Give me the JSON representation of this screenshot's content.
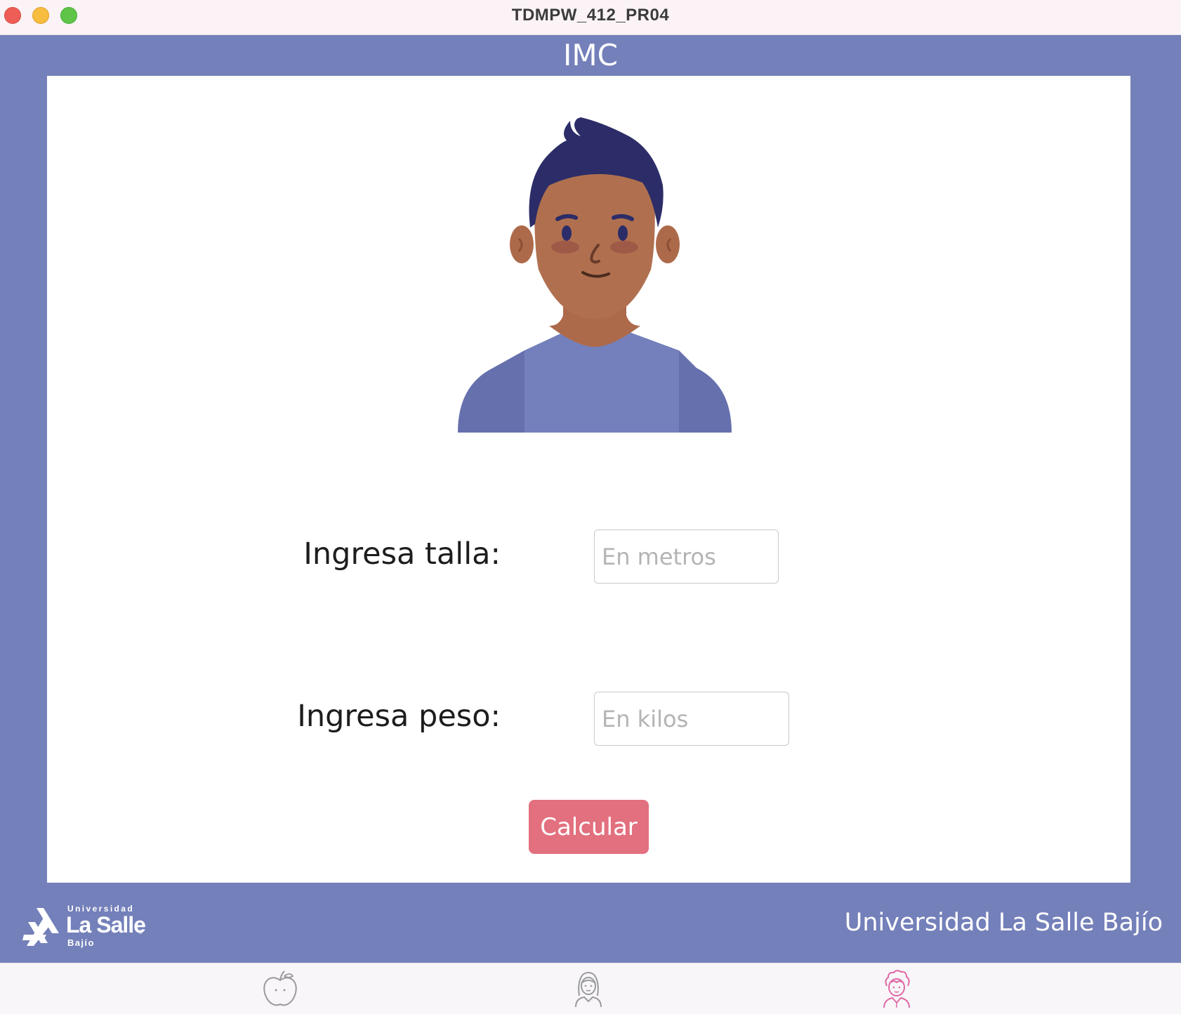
{
  "window": {
    "title": "TDMPW_412_PR04"
  },
  "header": {
    "title": "IMC"
  },
  "form": {
    "talla_label": "Ingresa talla:",
    "talla_placeholder": "En metros",
    "peso_label": "Ingresa peso:",
    "peso_placeholder": "En kilos",
    "submit_label": "Calcular"
  },
  "footer": {
    "logo": {
      "line1": "Universidad",
      "line2": "La Salle",
      "line3": "Bajío"
    },
    "institution": "Universidad La Salle Bajío"
  },
  "tabbar": {
    "tabs": [
      {
        "icon": "apple-icon",
        "selected": false
      },
      {
        "icon": "woman-avatar-icon",
        "selected": false
      },
      {
        "icon": "curly-avatar-icon",
        "selected": true
      }
    ]
  },
  "colors": {
    "band": "#7480ba",
    "button": "#e3707e",
    "tab_active": "#e06aa6",
    "tab_inactive": "#9a9a9a"
  }
}
